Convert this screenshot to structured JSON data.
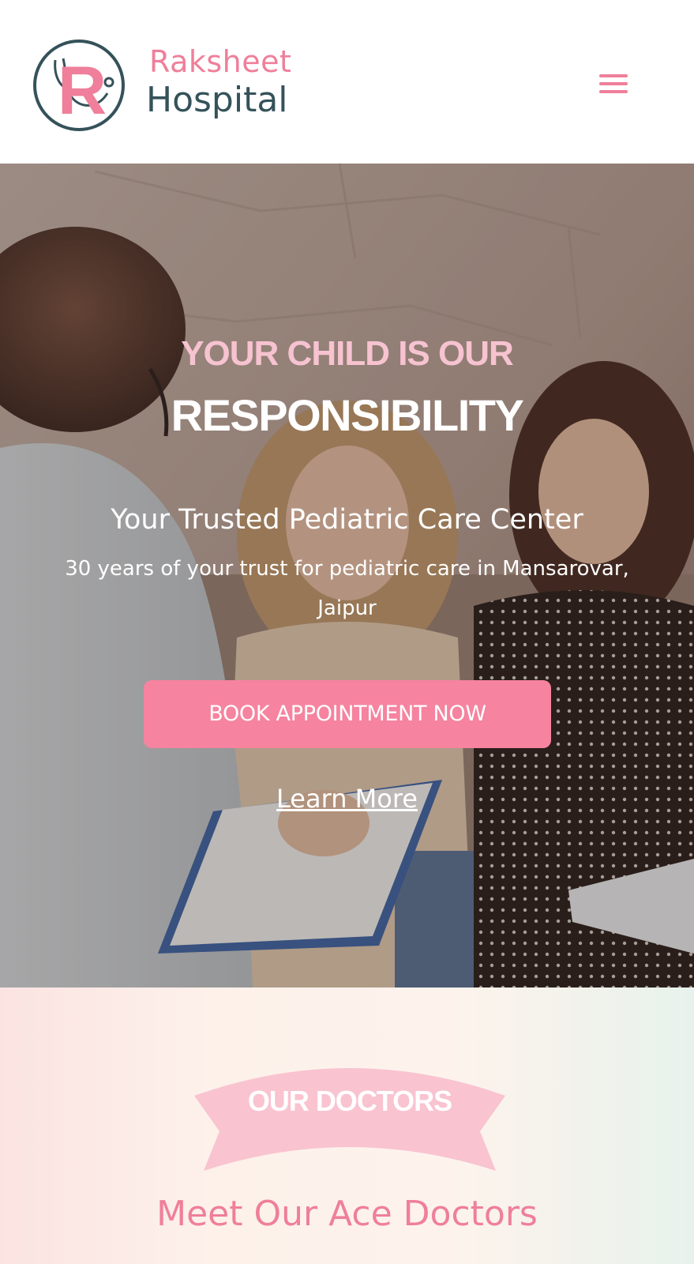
{
  "header": {
    "brand_line1": "Raksheet",
    "brand_line2": "Hospital",
    "logo_letter": "R",
    "menu_icon": "hamburger-menu-icon"
  },
  "hero": {
    "kicker": "YOUR CHILD IS OUR",
    "title": "RESPONSIBILITY",
    "subtitle": "Your Trusted Pediatric Care Center",
    "description": "30 years of your trust for pediatric care in Mansarovar, Jaipur",
    "cta_label": "BOOK APPOINTMENT NOW",
    "learn_more_label": "Learn More"
  },
  "doctors": {
    "ribbon_label": "OUR DOCTORS",
    "heading": "Meet Our Ace Doctors"
  },
  "colors": {
    "brand_pink": "#ef7f9a",
    "brand_teal": "#35525a",
    "cta_pink": "#f6839f",
    "kicker_pink": "#f7c3d1",
    "ribbon_pink": "#f9c3d0"
  }
}
